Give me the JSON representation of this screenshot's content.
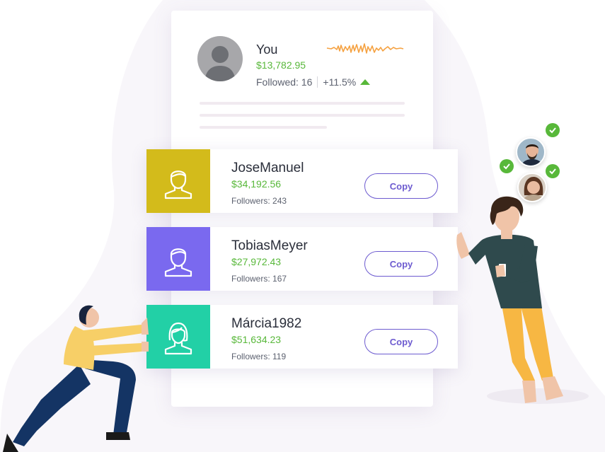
{
  "you": {
    "name": "You",
    "value": "$13,782.95",
    "followed": "Followed: 16",
    "change": "+11.5%"
  },
  "traders": [
    {
      "name": "JoseManuel",
      "value": "$34,192.56",
      "followers": "Followers: 243",
      "color": "#d3bb1b",
      "icon": "user-male-icon",
      "button": "Copy"
    },
    {
      "name": "TobiasMeyer",
      "value": "$27,972.43",
      "followers": "Followers: 167",
      "color": "#7a69ef",
      "icon": "user-male-icon",
      "button": "Copy"
    },
    {
      "name": "Márcia1982",
      "value": "$51,634.23",
      "followers": "Followers: 119",
      "color": "#22d0a6",
      "icon": "user-female-icon",
      "button": "Copy"
    }
  ],
  "colors": {
    "accent": "#6d5bd0",
    "positive": "#58b83a",
    "sparkline": "#f5a242"
  }
}
